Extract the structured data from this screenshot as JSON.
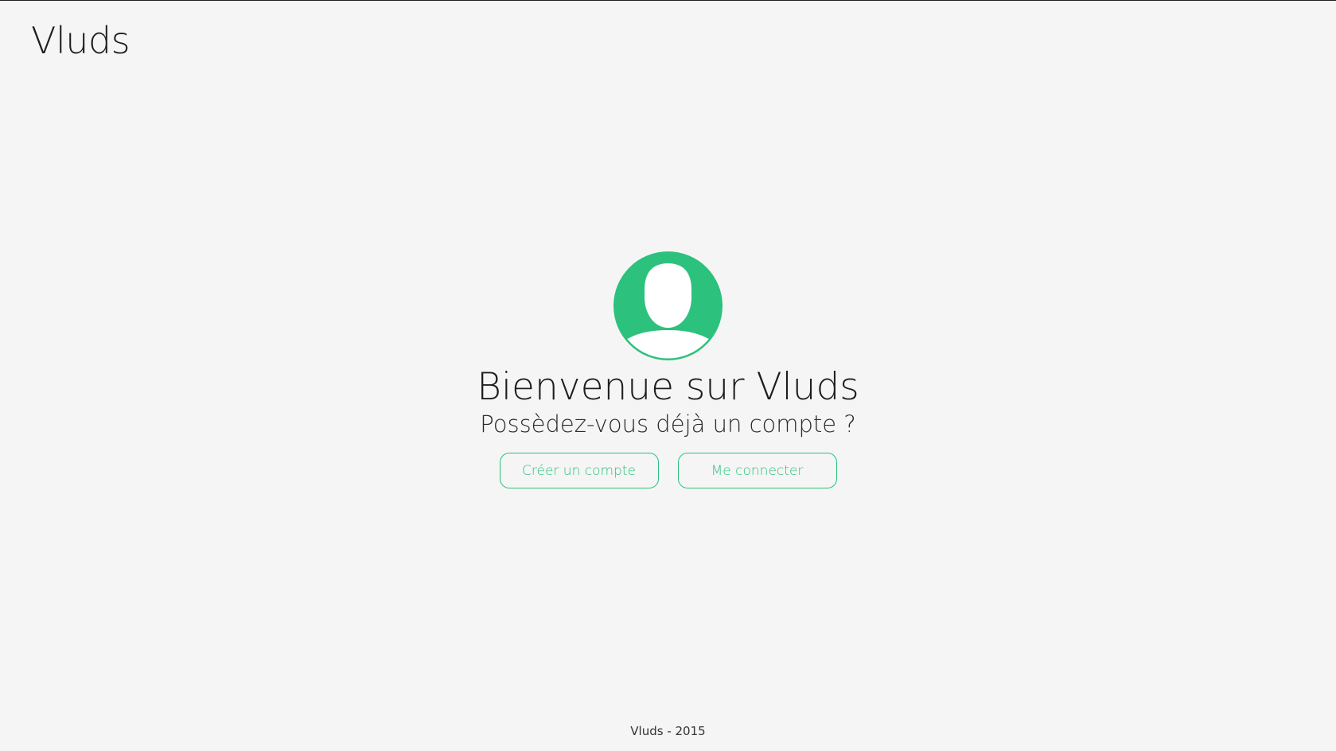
{
  "header": {
    "brand": "Vluds"
  },
  "hero": {
    "avatar_icon": "user-avatar-icon",
    "title": "Bienvenue sur Vluds",
    "subtitle": "Possèdez-vous déjà un compte ?",
    "create_account_label": "Créer un compte",
    "login_label": "Me connecter"
  },
  "footer": {
    "text": "Vluds - 2015"
  },
  "colors": {
    "accent": "#2cc17d",
    "background": "#f5f5f5",
    "text": "#1e1e1e"
  }
}
